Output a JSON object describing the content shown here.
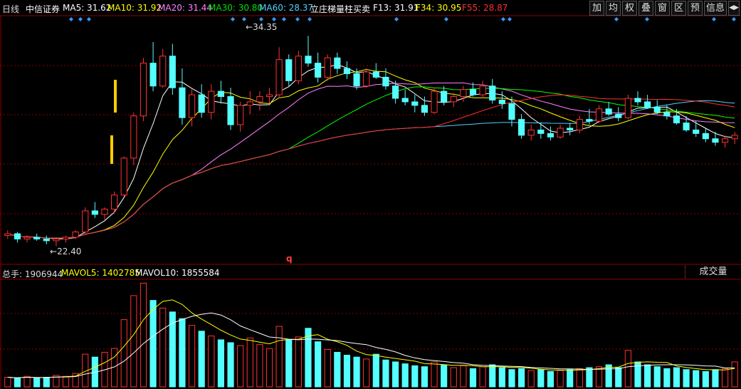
{
  "header": {
    "period": "日线",
    "stock_name": "中信证券",
    "ma5": "MA5: 31.62",
    "ma10": "MA10: 31.92",
    "ma20": "MA20: 31.44",
    "ma30": "MA30: 30.80",
    "ma60": "MA60: 28.37",
    "indicator": "立庄梯量柱买卖",
    "f13": "F13: 31.91",
    "f34": "F34: 30.95",
    "f55": "F55: 28.87"
  },
  "toolbar": {
    "buttons": [
      "加",
      "均",
      "权",
      "叠",
      "窗",
      "区",
      "预",
      "信息"
    ],
    "arrow": "◀▶"
  },
  "annotations": {
    "high": "34.35",
    "low": "22.40",
    "q": "q"
  },
  "volume": {
    "total": "总手: 1906944",
    "mavol5": "MAVOL5: 1402785",
    "mavol10": "MAVOL10: 1855584",
    "tab": "成交量"
  },
  "colors": {
    "up": "#ff3232",
    "down": "#54ffff",
    "ma5": "#ffffff",
    "ma10": "#ffff00",
    "ma20": "#ff80ff",
    "ma30": "#00ff00",
    "ma60": "#54d0ff",
    "f55": "#ff3030",
    "grid": "#8b0000",
    "signal": "#ffcc00",
    "diamond": "#3399ff"
  },
  "chart_data": {
    "type": "candlestick",
    "price_high_label": 34.35,
    "price_low_label": 22.4,
    "candles": [
      [
        23.0,
        23.3,
        22.8,
        23.1
      ],
      [
        23.1,
        23.2,
        22.6,
        22.8
      ],
      [
        22.8,
        23.0,
        22.6,
        22.9
      ],
      [
        22.9,
        23.1,
        22.7,
        22.8
      ],
      [
        22.8,
        23.0,
        22.5,
        22.7
      ],
      [
        22.7,
        22.9,
        22.4,
        22.8
      ],
      [
        22.8,
        23.0,
        22.6,
        22.9
      ],
      [
        22.9,
        23.3,
        22.8,
        23.2
      ],
      [
        23.2,
        24.6,
        23.1,
        24.4
      ],
      [
        24.4,
        24.9,
        24.0,
        24.2
      ],
      [
        24.2,
        24.6,
        23.9,
        24.5
      ],
      [
        24.5,
        25.5,
        24.3,
        25.3
      ],
      [
        25.3,
        27.5,
        25.2,
        27.4
      ],
      [
        27.4,
        30.0,
        27.0,
        29.8
      ],
      [
        29.8,
        33.1,
        29.5,
        32.8
      ],
      [
        32.8,
        34.0,
        31.2,
        31.5
      ],
      [
        31.5,
        33.6,
        31.4,
        33.2
      ],
      [
        33.2,
        33.9,
        31.0,
        31.4
      ],
      [
        31.4,
        32.5,
        29.3,
        29.7
      ],
      [
        29.7,
        31.3,
        29.2,
        31.0
      ],
      [
        31.0,
        31.6,
        29.7,
        30.0
      ],
      [
        30.0,
        31.6,
        29.6,
        31.2
      ],
      [
        31.2,
        31.8,
        30.5,
        30.9
      ],
      [
        30.9,
        31.4,
        29.0,
        29.3
      ],
      [
        29.3,
        30.6,
        28.9,
        30.4
      ],
      [
        30.4,
        31.2,
        29.9,
        30.6
      ],
      [
        30.6,
        31.2,
        30.1,
        30.9
      ],
      [
        30.9,
        31.4,
        30.5,
        31.0
      ],
      [
        31.0,
        33.7,
        30.8,
        33.0
      ],
      [
        33.0,
        33.3,
        31.5,
        31.8
      ],
      [
        31.8,
        33.5,
        31.6,
        33.2
      ],
      [
        33.2,
        34.35,
        32.6,
        32.8
      ],
      [
        32.8,
        33.4,
        31.7,
        32.0
      ],
      [
        32.0,
        33.3,
        31.8,
        33.1
      ],
      [
        33.1,
        33.4,
        32.2,
        32.5
      ],
      [
        32.5,
        32.9,
        31.9,
        32.2
      ],
      [
        32.2,
        32.5,
        31.3,
        31.5
      ],
      [
        31.5,
        32.5,
        31.4,
        32.3
      ],
      [
        32.3,
        32.8,
        31.9,
        32.0
      ],
      [
        32.0,
        32.5,
        31.3,
        31.5
      ],
      [
        31.5,
        31.8,
        30.5,
        30.8
      ],
      [
        30.8,
        31.3,
        30.4,
        30.6
      ],
      [
        30.6,
        31.0,
        30.0,
        30.4
      ],
      [
        30.4,
        30.9,
        29.8,
        30.0
      ],
      [
        30.0,
        31.4,
        29.9,
        31.2
      ],
      [
        31.2,
        31.5,
        30.4,
        30.6
      ],
      [
        30.6,
        31.1,
        30.3,
        30.9
      ],
      [
        30.9,
        31.5,
        30.6,
        31.3
      ],
      [
        31.3,
        31.7,
        30.9,
        31.0
      ],
      [
        31.0,
        31.8,
        30.8,
        31.5
      ],
      [
        31.5,
        31.9,
        30.5,
        30.7
      ],
      [
        30.7,
        31.2,
        30.2,
        30.5
      ],
      [
        30.5,
        30.9,
        29.2,
        29.6
      ],
      [
        29.6,
        29.9,
        28.5,
        28.7
      ],
      [
        28.7,
        29.3,
        28.4,
        29.0
      ],
      [
        29.0,
        29.4,
        28.5,
        28.8
      ],
      [
        28.8,
        29.2,
        28.4,
        28.6
      ],
      [
        28.6,
        29.3,
        28.5,
        29.1
      ],
      [
        29.1,
        29.4,
        28.7,
        29.0
      ],
      [
        29.0,
        29.8,
        28.8,
        29.6
      ],
      [
        29.6,
        30.2,
        29.3,
        29.5
      ],
      [
        29.5,
        30.4,
        29.4,
        30.2
      ],
      [
        30.2,
        30.6,
        29.8,
        29.9
      ],
      [
        29.9,
        30.3,
        29.5,
        29.7
      ],
      [
        29.7,
        31.0,
        29.6,
        30.8
      ],
      [
        30.8,
        31.2,
        30.4,
        30.6
      ],
      [
        30.6,
        31.0,
        30.2,
        30.3
      ],
      [
        30.3,
        30.7,
        29.9,
        30.0
      ],
      [
        30.0,
        30.4,
        29.6,
        29.8
      ],
      [
        29.8,
        30.2,
        29.3,
        29.4
      ],
      [
        29.4,
        29.8,
        28.9,
        29.0
      ],
      [
        29.0,
        29.5,
        28.6,
        28.8
      ],
      [
        28.8,
        29.1,
        28.3,
        28.5
      ],
      [
        28.5,
        28.9,
        28.1,
        28.3
      ],
      [
        28.3,
        28.7,
        28.0,
        28.5
      ],
      [
        28.5,
        28.9,
        28.2,
        28.7
      ]
    ],
    "volume_values": [
      1.0,
      0.9,
      1.1,
      0.9,
      1.0,
      1.2,
      1.1,
      1.4,
      3.4,
      3.1,
      3.6,
      4.0,
      7.0,
      9.5,
      10.8,
      9.0,
      8.2,
      7.8,
      7.1,
      6.4,
      5.8,
      5.3,
      4.9,
      4.6,
      4.3,
      5.1,
      4.4,
      4.0,
      6.3,
      4.9,
      5.2,
      6.1,
      4.7,
      3.9,
      3.6,
      3.3,
      3.1,
      2.9,
      3.4,
      2.8,
      2.6,
      2.4,
      2.2,
      2.1,
      2.6,
      2.3,
      2.0,
      2.2,
      1.9,
      2.1,
      2.3,
      2.0,
      1.8,
      1.9,
      1.7,
      1.8,
      1.6,
      1.7,
      1.8,
      1.9,
      2.0,
      2.1,
      2.3,
      2.0,
      3.8,
      2.6,
      2.3,
      2.1,
      1.9,
      2.0,
      1.8,
      1.7,
      1.6,
      1.8,
      1.9,
      2.6
    ],
    "ma_series": [
      {
        "name": "MA5",
        "values": [
          31.62
        ]
      },
      {
        "name": "MA10",
        "values": [
          31.92
        ]
      },
      {
        "name": "MA20",
        "values": [
          31.44
        ]
      },
      {
        "name": "MA30",
        "values": [
          30.8
        ]
      },
      {
        "name": "MA60",
        "values": [
          28.37
        ]
      }
    ],
    "volume_stats": {
      "total": 1906944,
      "mavol5": 1402785,
      "mavol10": 1855584
    },
    "grid": true
  }
}
